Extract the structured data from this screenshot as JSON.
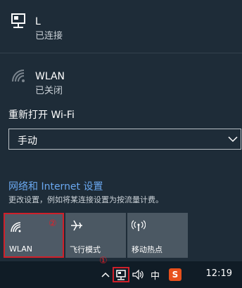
{
  "networks": [
    {
      "name": "L",
      "status": "已连接",
      "icon": "ethernet-monitor-icon"
    },
    {
      "name": "WLAN",
      "status": "已关闭",
      "icon": "wifi-off-icon"
    }
  ],
  "wifi_reopen": {
    "label": "重新打开 Wi-Fi",
    "selected": "手动"
  },
  "settings": {
    "link": "网络和 Internet 设置",
    "desc": "更改设置，例如将某连接设置为按流量计费。"
  },
  "tiles": [
    {
      "label": "WLAN",
      "icon": "wifi-icon",
      "active": true
    },
    {
      "label": "飞行模式",
      "icon": "airplane-icon",
      "active": false
    },
    {
      "label": "移动热点",
      "icon": "hotspot-icon",
      "active": false
    }
  ],
  "markers": {
    "one": "①",
    "two": "②"
  },
  "taskbar": {
    "ime": "中",
    "sogou": "S",
    "time": "12:19"
  },
  "colors": {
    "accent": "#6aa8f0",
    "highlight": "#d0202a",
    "sogou": "#e8501c"
  }
}
